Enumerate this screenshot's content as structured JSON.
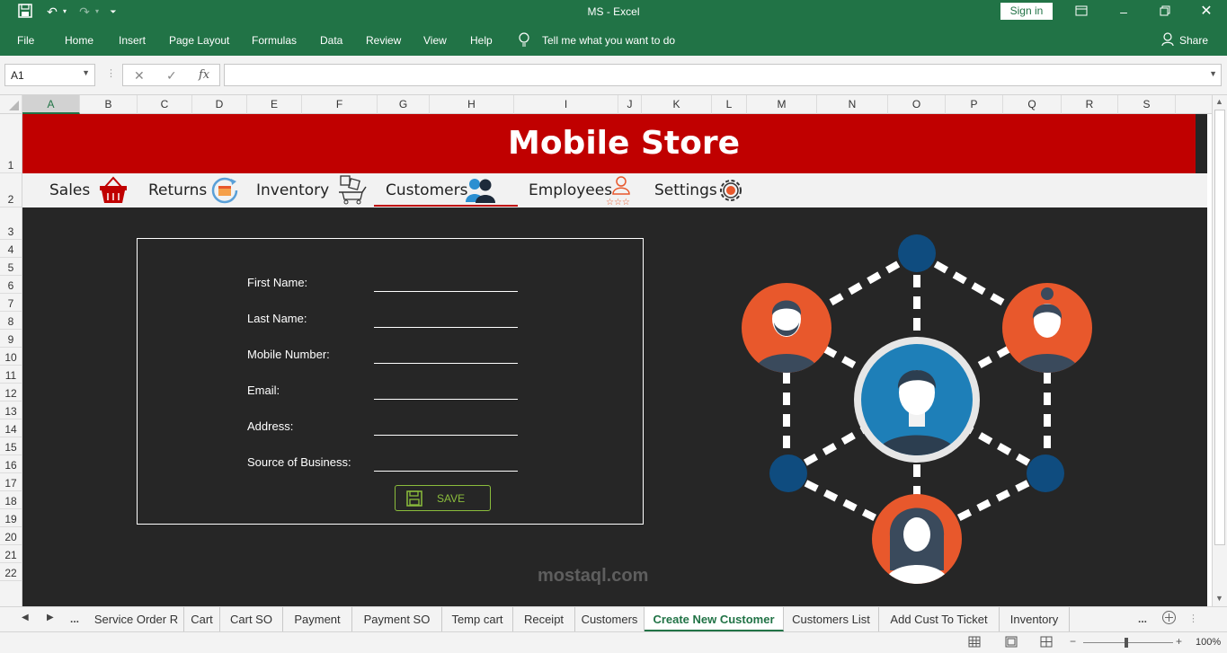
{
  "window": {
    "title": "MS  -  Excel",
    "sign_in": "Sign in",
    "share": "Share"
  },
  "menu": {
    "items": [
      "File",
      "Home",
      "Insert",
      "Page Layout",
      "Formulas",
      "Data",
      "Review",
      "View",
      "Help"
    ],
    "tell_me": "Tell me what you want to do"
  },
  "formula_bar": {
    "name_box": "A1",
    "fx": "fx",
    "value": ""
  },
  "columns": [
    "A",
    "B",
    "C",
    "D",
    "E",
    "F",
    "G",
    "H",
    "I",
    "J",
    "K",
    "L",
    "M",
    "N",
    "O",
    "P",
    "Q",
    "R",
    "S"
  ],
  "rows": [
    "1",
    "2",
    "3",
    "4",
    "5",
    "6",
    "7",
    "8",
    "9",
    "10",
    "11",
    "12",
    "13",
    "14",
    "15",
    "16",
    "17",
    "18",
    "19",
    "20",
    "21",
    "22"
  ],
  "banner": {
    "title": "Mobile Store"
  },
  "nav": {
    "items": [
      {
        "label": "Sales",
        "icon": "basket-icon"
      },
      {
        "label": "Returns",
        "icon": "return-icon"
      },
      {
        "label": "Inventory",
        "icon": "cart-boxes-icon"
      },
      {
        "label": "Customers",
        "icon": "users-icon"
      },
      {
        "label": "Employees",
        "icon": "employee-stars-icon"
      },
      {
        "label": "Settings",
        "icon": "gear-icon"
      }
    ],
    "active": "Customers"
  },
  "form": {
    "fields": [
      {
        "label": "First Name:",
        "value": ""
      },
      {
        "label": "Last Name:",
        "value": ""
      },
      {
        "label": "Mobile Number:",
        "value": ""
      },
      {
        "label": "Email:",
        "value": ""
      },
      {
        "label": "Address:",
        "value": ""
      },
      {
        "label": "Source of Business:",
        "value": ""
      }
    ],
    "save_label": "SAVE"
  },
  "sheet_tabs": {
    "items": [
      "Service Order R",
      "Cart",
      "Cart SO",
      "Payment",
      "Payment SO",
      "Temp cart",
      "Receipt",
      "Customers",
      "Create New Customer",
      "Customers List",
      "Add Cust To Ticket",
      "Inventory"
    ],
    "active": "Create New Customer",
    "more": "..."
  },
  "status": {
    "zoom": "100%"
  },
  "watermark": "mostaql.com",
  "colors": {
    "excel_green": "#217346",
    "banner_red": "#c00000",
    "sheet_bg": "#262626",
    "accent_orange": "#e8582c",
    "accent_blue": "#1e7fb8",
    "node_blue": "#0f4c7f",
    "save_green": "#8bbd3c"
  }
}
